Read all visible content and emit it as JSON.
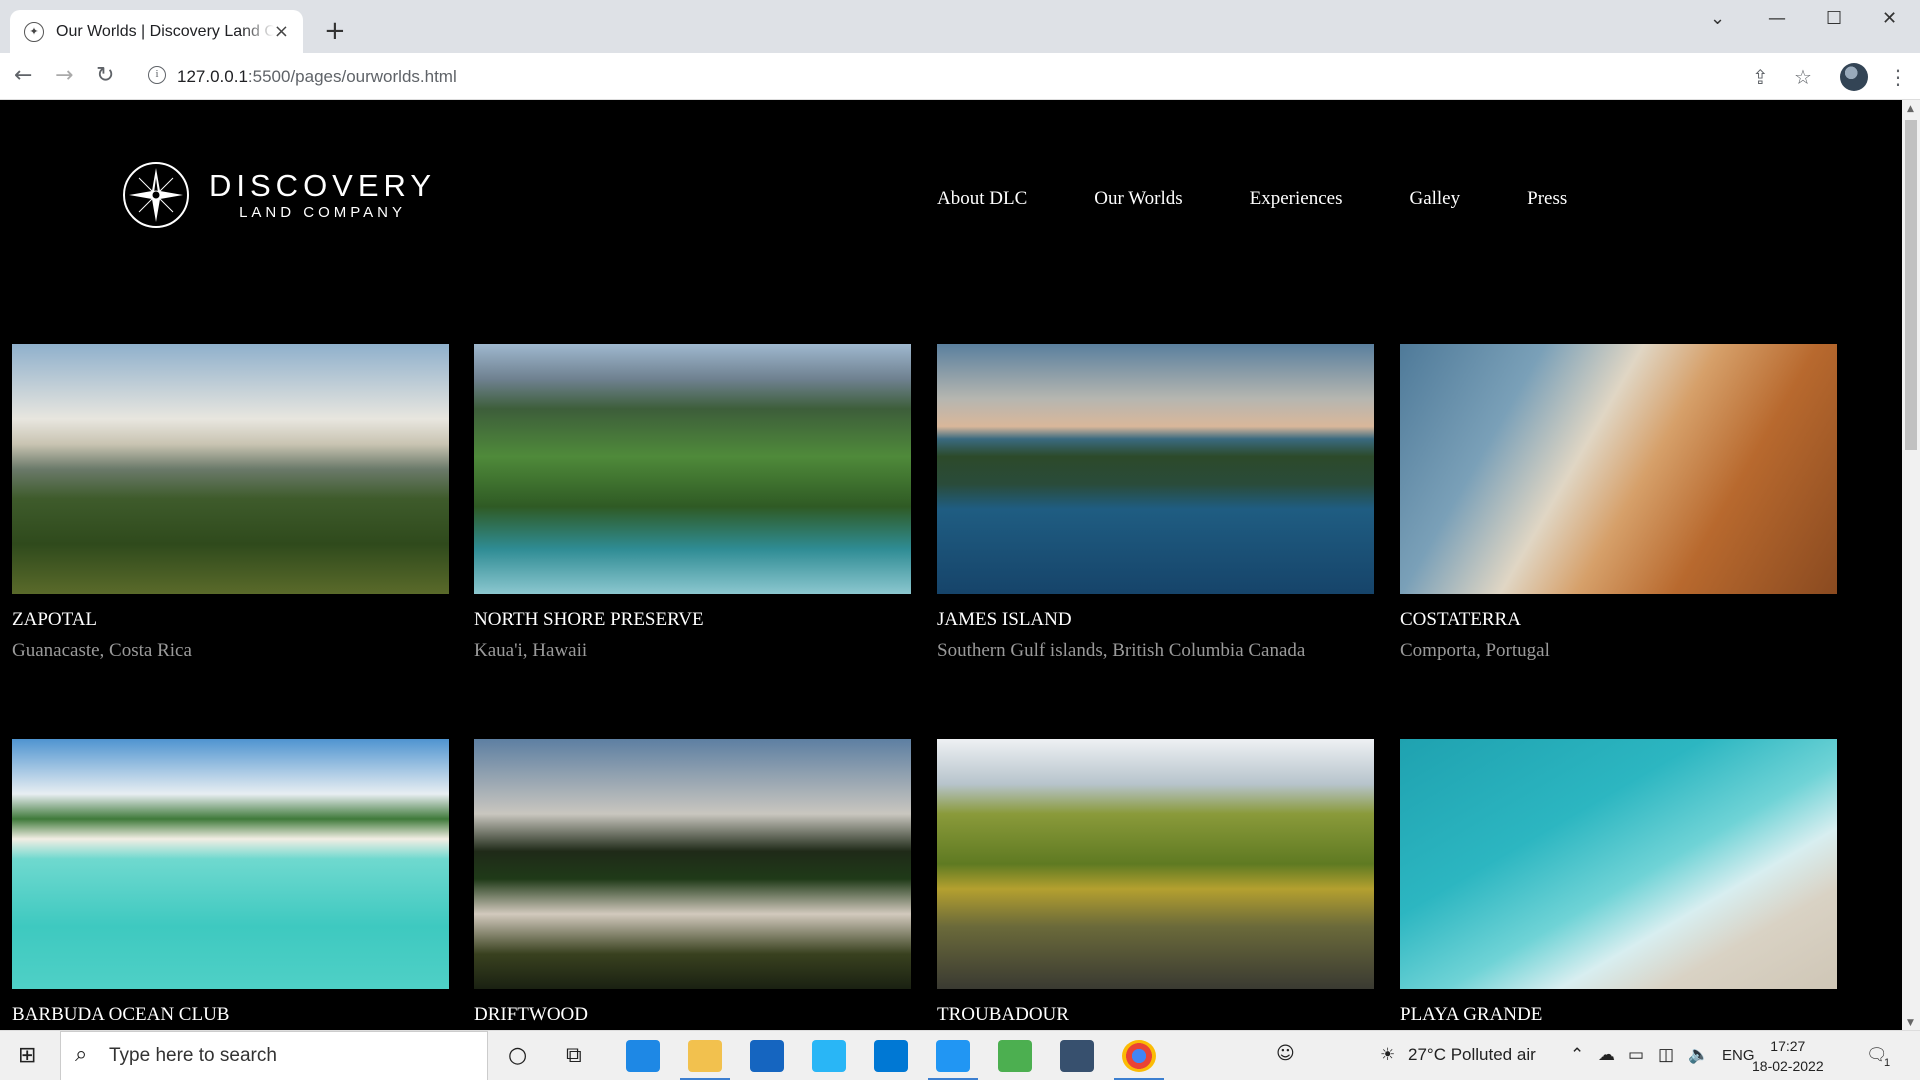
{
  "browser": {
    "tab_title": "Our Worlds | Discovery Land Company",
    "tab_close": "×",
    "new_tab": "+",
    "url_host": "127.0.0.1",
    "url_path": ":5500/pages/ourworlds.html",
    "window_controls": [
      "minimize",
      "maximize",
      "close"
    ]
  },
  "site": {
    "logo_line1": "DISCOVERY",
    "logo_line2": "LAND COMPANY",
    "nav": [
      "About DLC",
      "Our Worlds",
      "Experiences",
      "Galley",
      "Press"
    ]
  },
  "cards": [
    {
      "name": "ZAPOTAL",
      "location": "Guanacaste, Costa Rica"
    },
    {
      "name": "NORTH SHORE PRESERVE",
      "location": "Kaua'i, Hawaii"
    },
    {
      "name": "JAMES ISLAND",
      "location": "Southern Gulf islands, British Columbia Canada"
    },
    {
      "name": "COSTATERRA",
      "location": "Comporta, Portugal"
    },
    {
      "name": "BARBUDA OCEAN CLUB",
      "location": ""
    },
    {
      "name": "DRIFTWOOD",
      "location": ""
    },
    {
      "name": "TROUBADOUR",
      "location": ""
    },
    {
      "name": "PLAYA GRANDE",
      "location": ""
    }
  ],
  "taskbar": {
    "search_placeholder": "Type here to search",
    "weather": "27°C  Polluted air",
    "language": "ENG",
    "time": "17:27",
    "date": "18-02-2022",
    "notification_count": "1"
  }
}
